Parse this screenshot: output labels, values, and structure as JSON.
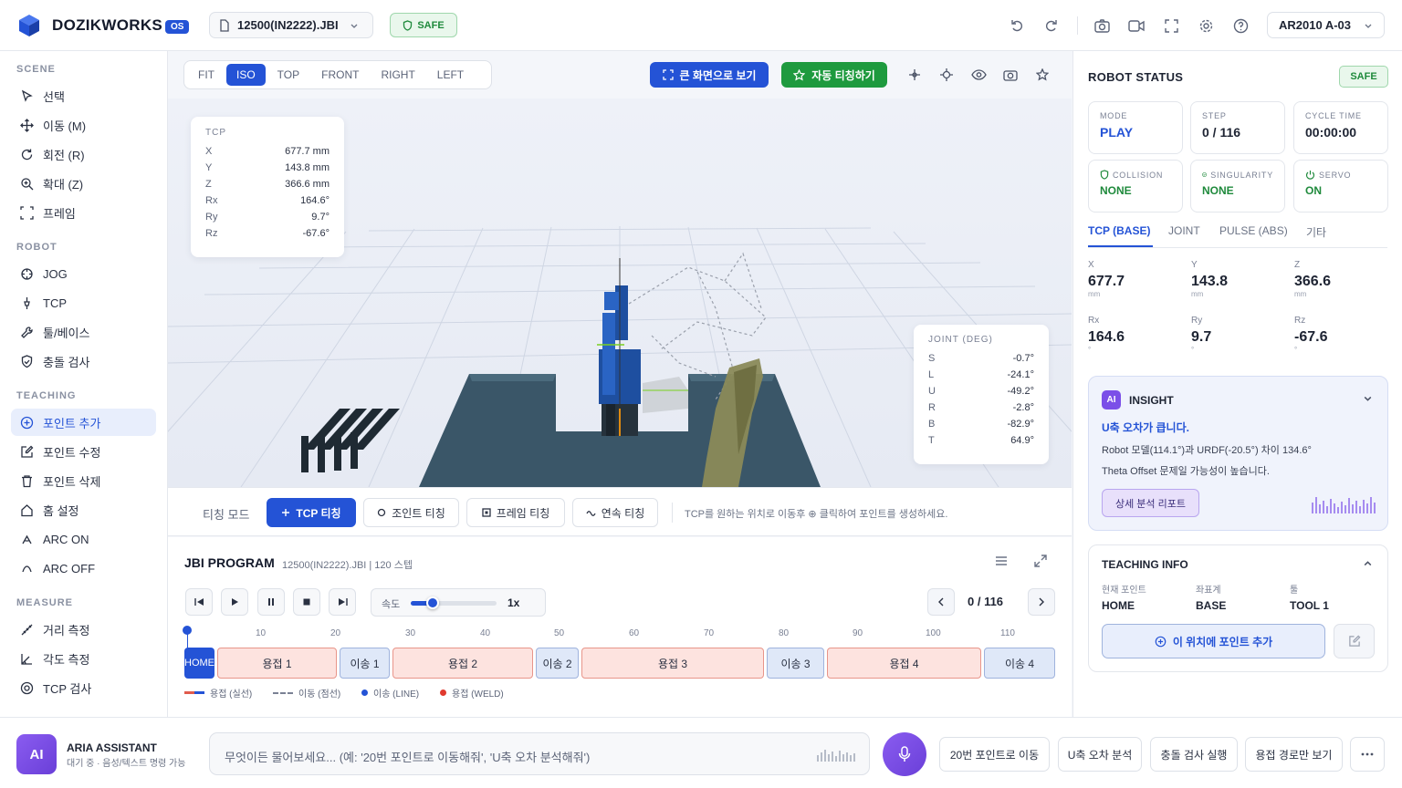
{
  "colors": {
    "accent": "#2453d6",
    "safe": "#1f8a3c",
    "weld": "#e8958a",
    "move": "#9fb3dd",
    "ai": "#7b4fe8"
  },
  "topbar": {
    "brand": "DOZIKWORKS",
    "os_badge": "OS",
    "file": "12500(IN2222).JBI",
    "safe": "SAFE",
    "robot": "AR2010 A-03"
  },
  "sidebar": {
    "sections": [
      {
        "title": "SCENE",
        "items": [
          "선택",
          "이동 (M)",
          "회전 (R)",
          "확대 (Z)",
          "프레임"
        ]
      },
      {
        "title": "ROBOT",
        "items": [
          "JOG",
          "TCP",
          "툴/베이스",
          "충돌 검사"
        ]
      },
      {
        "title": "TEACHING",
        "items": [
          "포인트 추가",
          "포인트 수정",
          "포인트 삭제",
          "홈 설정",
          "ARC ON",
          "ARC OFF"
        ]
      },
      {
        "title": "MEASURE",
        "items": [
          "거리 측정",
          "각도 측정",
          "TCP 검사"
        ]
      }
    ]
  },
  "view": {
    "tabs": [
      "FIT",
      "ISO",
      "TOP",
      "FRONT",
      "RIGHT",
      "LEFT"
    ],
    "fullscreen_btn": "큰 화면으로 보기",
    "auto_teach_btn": "자동 티칭하기"
  },
  "tcp_card": {
    "title": "TCP",
    "rows": [
      [
        "X",
        "677.7 mm"
      ],
      [
        "Y",
        "143.8 mm"
      ],
      [
        "Z",
        "366.6 mm"
      ],
      [
        "Rx",
        "164.6°"
      ],
      [
        "Ry",
        "9.7°"
      ],
      [
        "Rz",
        "-67.6°"
      ]
    ]
  },
  "joint_card": {
    "title": "JOINT (DEG)",
    "rows": [
      [
        "S",
        "-0.7°"
      ],
      [
        "L",
        "-24.1°"
      ],
      [
        "U",
        "-49.2°"
      ],
      [
        "R",
        "-2.8°"
      ],
      [
        "B",
        "-82.9°"
      ],
      [
        "T",
        "64.9°"
      ]
    ]
  },
  "teach": {
    "mode_label": "티칭 모드",
    "buttons": [
      "TCP 티칭",
      "조인트 티칭",
      "프레임 티칭",
      "연속 티칭"
    ],
    "hint": "TCP를 원하는 위치로 이동후 ⊕ 클릭하여 포인트를 생성하세요."
  },
  "program": {
    "title": "JBI PROGRAM",
    "meta": "12500(IN2222).JBI | 120 스텝",
    "speed_label": "속도",
    "speed_value": "1x",
    "speed_fraction": 0.26,
    "step": "0 / 116",
    "ticks": [
      "10",
      "20",
      "30",
      "40",
      "50",
      "60",
      "70",
      "80",
      "90",
      "100",
      "110"
    ],
    "segments": [
      {
        "label": "HOME",
        "kind": "home"
      },
      {
        "label": "용접 1",
        "kind": "weld"
      },
      {
        "label": "이송 1",
        "kind": "move"
      },
      {
        "label": "용접 2",
        "kind": "weld"
      },
      {
        "label": "이송 2",
        "kind": "move"
      },
      {
        "label": "용접 3",
        "kind": "weld"
      },
      {
        "label": "이송 3",
        "kind": "move"
      },
      {
        "label": "용접 4",
        "kind": "weld"
      },
      {
        "label": "이송 4",
        "kind": "move"
      }
    ],
    "legend": [
      "용접 (실선)",
      "이동 (점선)",
      "이송 (LINE)",
      "용접 (WELD)"
    ]
  },
  "status": {
    "title": "ROBOT STATUS",
    "safe": "SAFE",
    "boxes": [
      {
        "label": "MODE",
        "value": "PLAY"
      },
      {
        "label": "STEP",
        "value": "0 / 116"
      },
      {
        "label": "CYCLE TIME",
        "value": "00:00:00"
      },
      {
        "label": "COLLISION",
        "value": "NONE"
      },
      {
        "label": "SINGULARITY",
        "value": "NONE"
      },
      {
        "label": "SERVO",
        "value": "ON"
      }
    ],
    "tabs": [
      "TCP (BASE)",
      "JOINT",
      "PULSE (ABS)",
      "기타"
    ],
    "coords": [
      {
        "label": "X",
        "value": "677.7",
        "unit": "mm"
      },
      {
        "label": "Y",
        "value": "143.8",
        "unit": "mm"
      },
      {
        "label": "Z",
        "value": "366.6",
        "unit": "mm"
      },
      {
        "label": "Rx",
        "value": "164.6",
        "unit": "°"
      },
      {
        "label": "Ry",
        "value": "9.7",
        "unit": "°"
      },
      {
        "label": "Rz",
        "value": "-67.6",
        "unit": "°"
      }
    ]
  },
  "insight": {
    "badge": "AI",
    "title": "INSIGHT",
    "headline": "U축 오차가 큽니다.",
    "line1": "Robot 모델(114.1°)과 URDF(-20.5°) 차이 134.6°",
    "line2": "Theta Offset 문제일 가능성이 높습니다.",
    "button": "상세 분석 리포트"
  },
  "teaching_info": {
    "title": "TEACHING INFO",
    "cols": [
      {
        "label": "현재 포인트",
        "value": "HOME"
      },
      {
        "label": "좌표계",
        "value": "BASE"
      },
      {
        "label": "툴",
        "value": "TOOL 1"
      }
    ],
    "add_btn": "이 위치에 포인트 추가"
  },
  "assistant": {
    "avatar": "AI",
    "name": "ARIA ASSISTANT",
    "status": "대기 중 · 음성/텍스트 명령 가능",
    "placeholder": "무엇이든 물어보세요... (예: '20번 포인트로 이동해줘', 'U축 오차 분석해줘')",
    "chips": [
      "20번 포인트로 이동",
      "U축 오차 분석",
      "충돌 검사 실행",
      "용접 경로만 보기"
    ]
  }
}
